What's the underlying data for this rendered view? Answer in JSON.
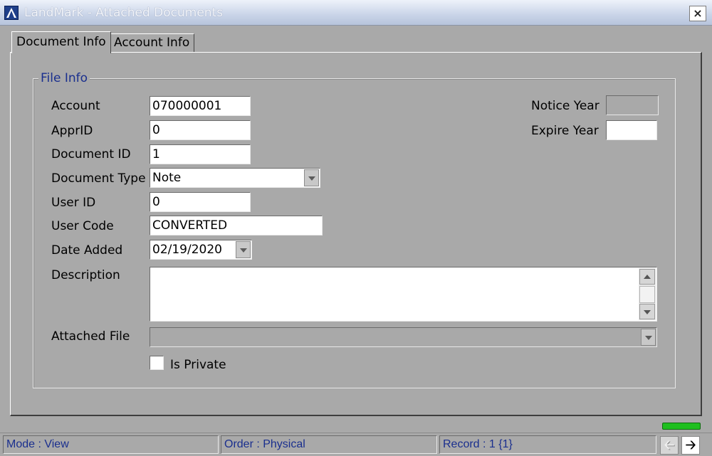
{
  "window": {
    "title": "LandMark - Attached Documents",
    "close_label": "×"
  },
  "tabs": [
    {
      "label": "Document Info"
    },
    {
      "label": "Account Info"
    }
  ],
  "group": {
    "legend": "File Info"
  },
  "fields": {
    "account": {
      "label": "Account",
      "value": "070000001"
    },
    "appr_id": {
      "label": "ApprID",
      "value": "0"
    },
    "document_id": {
      "label": "Document ID",
      "value": "1"
    },
    "document_type": {
      "label": "Document Type",
      "value": "Note"
    },
    "user_id": {
      "label": "User ID",
      "value": "0"
    },
    "user_code": {
      "label": "User Code",
      "value": "CONVERTED"
    },
    "date_added": {
      "label": "Date Added",
      "value": "02/19/2020"
    },
    "description": {
      "label": "Description",
      "value": ""
    },
    "attached_file": {
      "label": "Attached File",
      "value": ""
    },
    "notice_year": {
      "label": "Notice Year",
      "value": ""
    },
    "expire_year": {
      "label": "Expire Year",
      "value": ""
    },
    "is_private": {
      "label": "Is Private",
      "checked": false
    }
  },
  "statusbar": {
    "mode": "Mode : View",
    "order": "Order : Physical",
    "record": "Record : 1 {1}"
  },
  "nav": {
    "prev_icon": "arrow-left-icon",
    "next_icon": "arrow-right-icon"
  },
  "colors": {
    "status_text": "#1a2f8e",
    "indicator": "#1fbf1f",
    "background": "#a9a9a9"
  }
}
